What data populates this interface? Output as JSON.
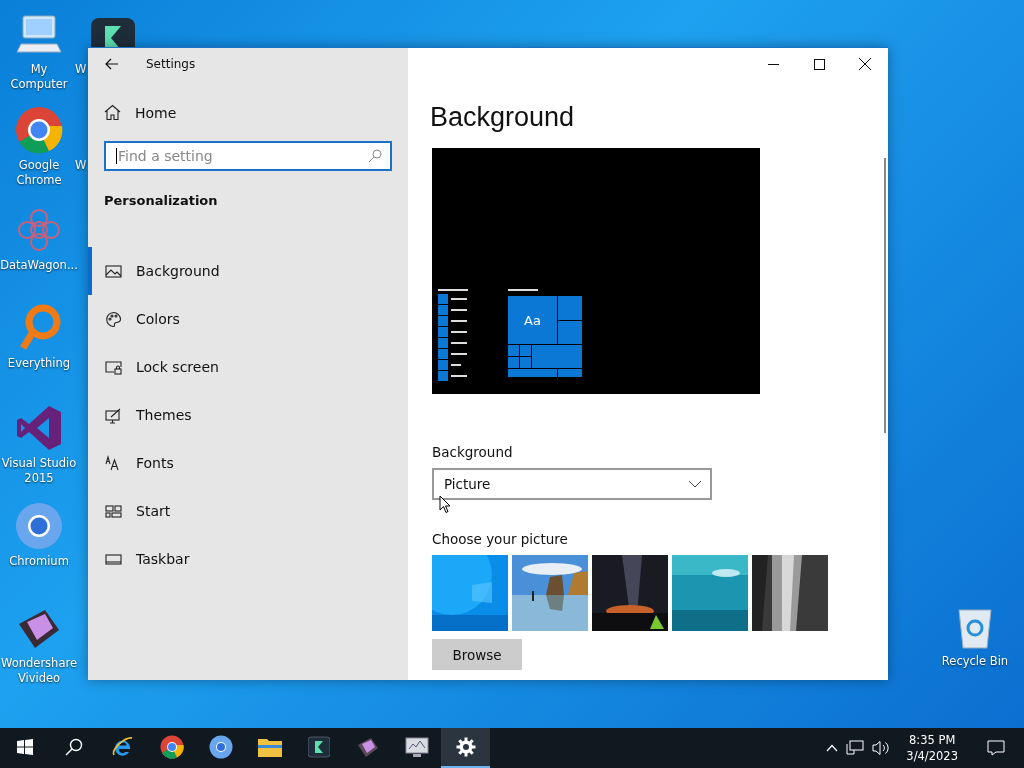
{
  "desktop_icons": [
    {
      "kind": "computer",
      "label": "My Computer"
    },
    {
      "kind": "filmora",
      "label": "W"
    },
    {
      "kind": "chrome",
      "label": "Google Chrome"
    },
    {
      "kind": "hidden",
      "label": "W"
    },
    {
      "kind": "datawagon",
      "label": "DataWagon..."
    },
    {
      "kind": "everything",
      "label": "Everything"
    },
    {
      "kind": "visualstudio",
      "label": "Visual Studio 2015"
    },
    {
      "kind": "chromium",
      "label": "Chromium"
    },
    {
      "kind": "vivideo",
      "label": "Wondershare Vivideo"
    },
    {
      "kind": "recyclebin",
      "label": "Recycle Bin"
    }
  ],
  "window": {
    "title": "Settings",
    "sidebar": {
      "home": "Home",
      "search": {
        "placeholder": "Find a setting"
      },
      "section": "Personalization",
      "items": [
        {
          "kind": "background",
          "label": "Background",
          "selected": true
        },
        {
          "kind": "colors",
          "label": "Colors",
          "selected": false
        },
        {
          "kind": "lock",
          "label": "Lock screen",
          "selected": false
        },
        {
          "kind": "themes",
          "label": "Themes",
          "selected": false
        },
        {
          "kind": "fonts",
          "label": "Fonts",
          "selected": false
        },
        {
          "kind": "start",
          "label": "Start",
          "selected": false
        },
        {
          "kind": "taskbar",
          "label": "Taskbar",
          "selected": false
        }
      ]
    },
    "content": {
      "heading": "Background",
      "preview": {
        "tile_text": "Aa"
      },
      "background_label": "Background",
      "background_value": "Picture",
      "choose_label": "Choose your picture",
      "browse": "Browse"
    }
  },
  "taskbar": {
    "apps": [
      {
        "kind": "start",
        "active": false
      },
      {
        "kind": "search",
        "active": false
      },
      {
        "kind": "ie",
        "active": false
      },
      {
        "kind": "chrome",
        "active": false
      },
      {
        "kind": "chromium",
        "active": false
      },
      {
        "kind": "explorer",
        "active": false
      },
      {
        "kind": "filmora",
        "active": false
      },
      {
        "kind": "vivideo",
        "active": false
      },
      {
        "kind": "monitor",
        "active": false
      },
      {
        "kind": "settings",
        "active": true
      }
    ],
    "time": "8:35 PM",
    "date": "3/4/2023"
  }
}
